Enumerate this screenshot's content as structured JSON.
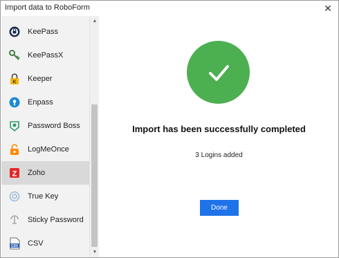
{
  "window": {
    "title": "Import data to RoboForm",
    "close_label": "✕"
  },
  "sidebar": {
    "items": [
      {
        "label": "KeePass",
        "icon": "keepass-icon"
      },
      {
        "label": "KeePassX",
        "icon": "keepassx-icon"
      },
      {
        "label": "Keeper",
        "icon": "keeper-icon"
      },
      {
        "label": "Enpass",
        "icon": "enpass-icon"
      },
      {
        "label": "Password Boss",
        "icon": "password-boss-icon"
      },
      {
        "label": "LogMeOnce",
        "icon": "logmeonce-icon"
      },
      {
        "label": "Zoho",
        "icon": "zoho-icon",
        "selected": true
      },
      {
        "label": "True Key",
        "icon": "true-key-icon"
      },
      {
        "label": "Sticky Password",
        "icon": "sticky-password-icon"
      },
      {
        "label": "CSV",
        "icon": "csv-icon"
      }
    ]
  },
  "scrollbar": {
    "up_arrow": "▲",
    "down_arrow": "▼"
  },
  "main": {
    "status_icon": "checkmark-icon",
    "headline": "Import has been successfully completed",
    "subtext": "3 Logins added",
    "done_label": "Done"
  },
  "colors": {
    "success_green": "#4caf50",
    "accent_blue": "#1e73e8",
    "selected_row": "#d9d9d9",
    "sidebar_bg": "#f2f2f2"
  }
}
